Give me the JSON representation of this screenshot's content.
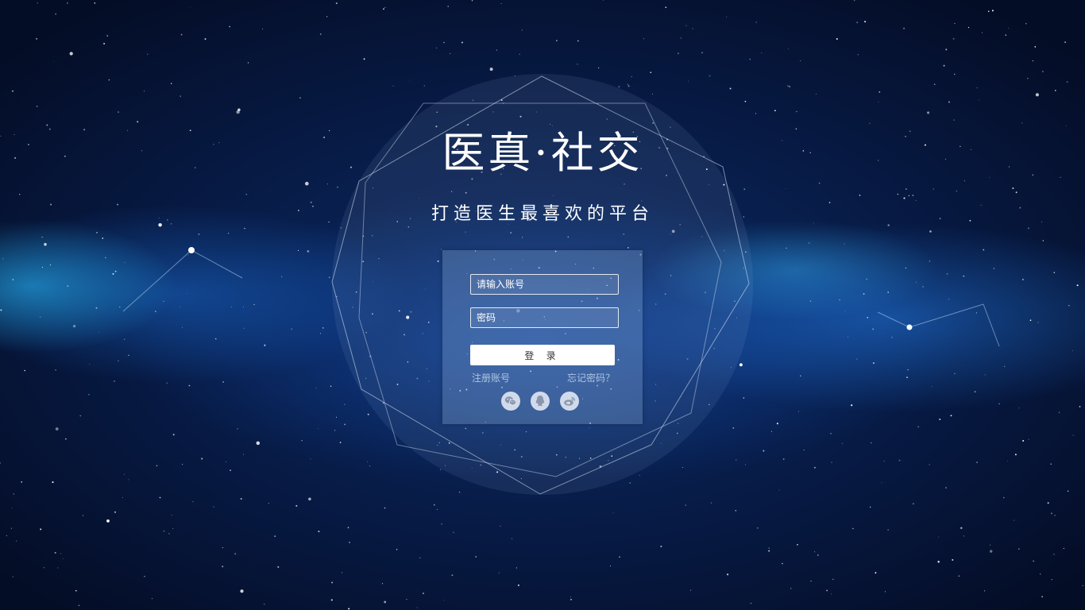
{
  "brand": {
    "logo_text": "医真·社交",
    "slogan": "打造医生最喜欢的平台"
  },
  "login_form": {
    "username_placeholder": "请输入账号",
    "password_placeholder": "密码",
    "login_button_label": "登 录",
    "register_link": "注册账号",
    "forgot_link": "忘记密码？"
  },
  "social_login": [
    {
      "icon": "wechat-icon"
    },
    {
      "icon": "qq-icon"
    },
    {
      "icon": "weibo-icon"
    }
  ],
  "colors": {
    "background_dark": "#040d26",
    "background_mid": "#0b2b66",
    "nebula_blue": "#2ba8ff",
    "panel": "#96b9e6",
    "button_bg": "#ffffff",
    "text": "#ffffff"
  }
}
